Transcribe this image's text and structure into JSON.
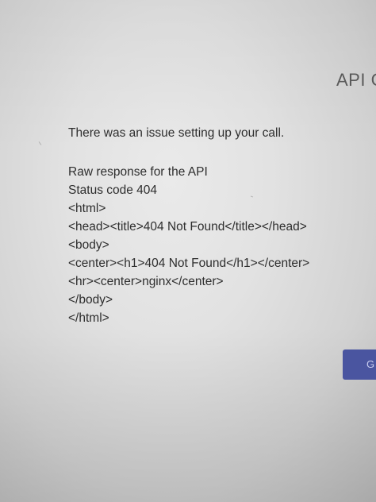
{
  "header": {
    "title": "API C"
  },
  "message": {
    "issue": "There was an issue setting up your call.",
    "response_lines": [
      "Raw response for the API",
      "Status code 404",
      "<html>",
      "<head><title>404 Not Found</title></head>",
      "<body>",
      "<center><h1>404 Not Found</h1></center>",
      "<hr><center>nginx</center>",
      "</body>",
      "</html>"
    ]
  },
  "side_button": {
    "label": "G"
  },
  "colors": {
    "background": "#e2e2e2",
    "text": "#2e2e2e",
    "button": "#4a55a0"
  }
}
